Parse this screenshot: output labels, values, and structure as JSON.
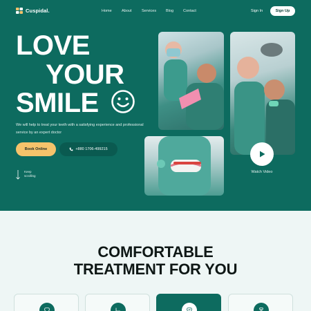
{
  "brand": {
    "name": "Cuspidal.",
    "accent": "#0d6b5f",
    "highlight": "#f5c36b"
  },
  "nav": {
    "items": [
      "Home",
      "About",
      "Services",
      "Blog",
      "Contact"
    ],
    "signin": "Sign In",
    "signup": "Sign Up"
  },
  "hero": {
    "line1": "LOVE",
    "line2": "YOUR",
    "line3": "SMILE",
    "description": "We will help to treat your teeth with a satisfying experience and professional service by an expert doctor",
    "book_label": "Book Online",
    "phone": "+880 1706-499215",
    "keep_scrolling": "Keep scrolling",
    "watch_video": "Watch Video"
  },
  "section": {
    "title_line1": "COMFORTABLE",
    "title_line2": "TREATMENT FOR YOU"
  },
  "cards": [
    {
      "icon": "tooth-icon"
    },
    {
      "icon": "dental-chair-icon"
    },
    {
      "icon": "tooth-check-icon"
    },
    {
      "icon": "implant-icon"
    }
  ]
}
